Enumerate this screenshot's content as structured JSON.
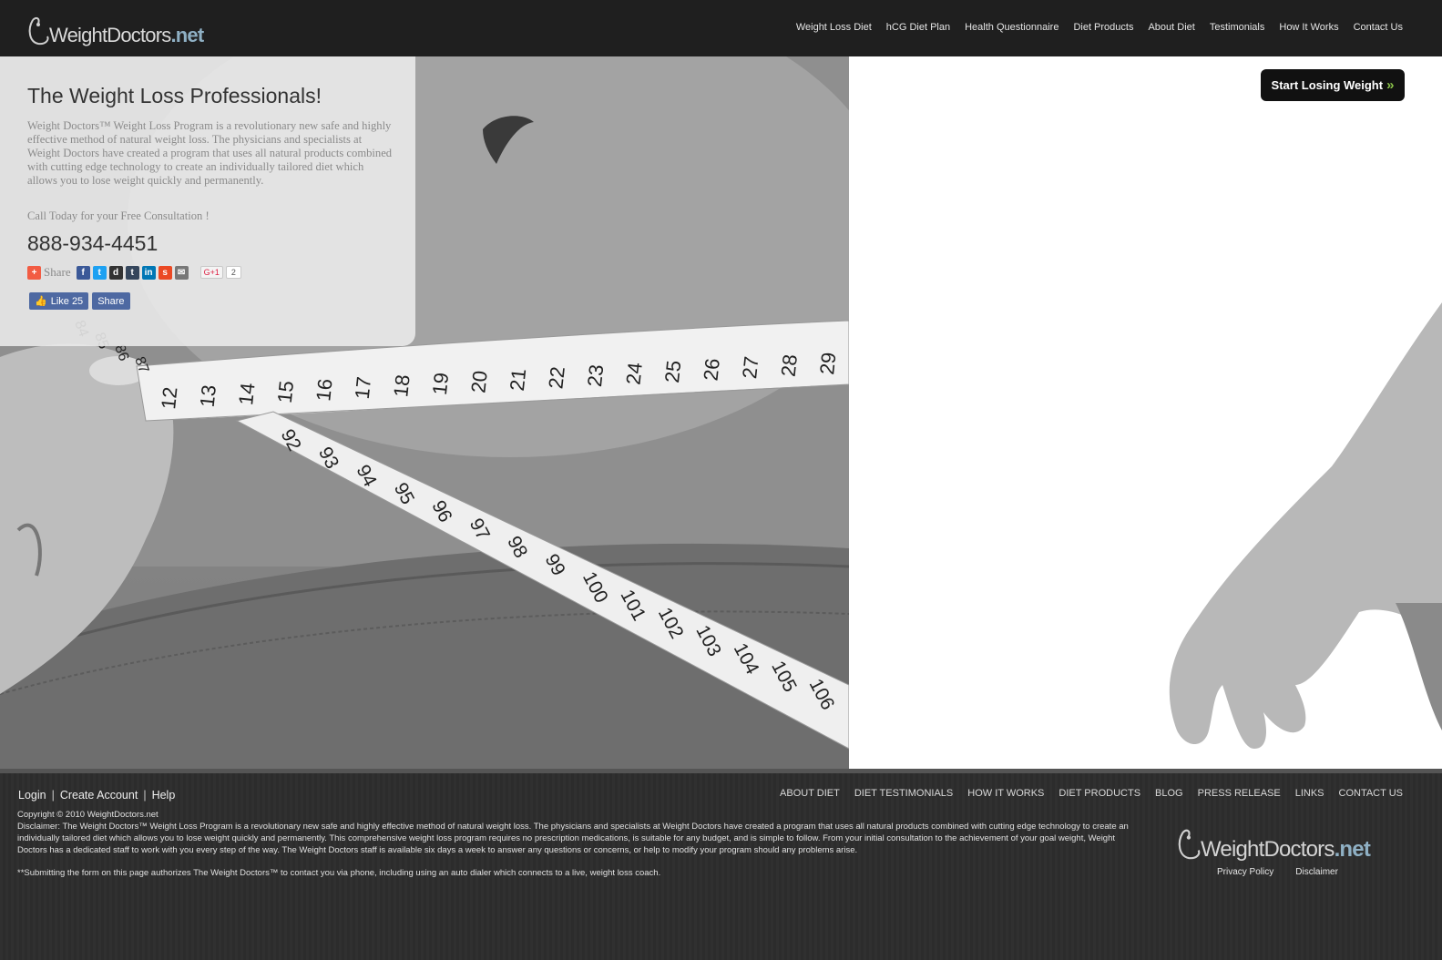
{
  "header": {
    "logo_main": "WeightDoctors",
    "logo_suffix": ".net",
    "nav": [
      {
        "label": "Weight Loss Diet"
      },
      {
        "label": "hCG Diet Plan"
      },
      {
        "label": "Health Questionnaire"
      },
      {
        "label": "Diet Products"
      },
      {
        "label": "About Diet"
      },
      {
        "label": "Testimonials"
      },
      {
        "label": "How It Works"
      },
      {
        "label": "Contact Us"
      }
    ]
  },
  "hero": {
    "title": "The Weight Loss Professionals!",
    "description": "Weight Doctors™ Weight Loss Program is a revolutionary new safe and highly effective method of natural weight loss. The physicians and specialists at Weight Doctors have created a program that uses all natural products combined with cutting edge technology to create an individually tailored diet which allows you to lose weight quickly and permanently.",
    "call_text": "Call Today for your Free Consultation !",
    "phone": "888-934-4451",
    "share_label": "Share",
    "share_icons": [
      "plus-icon",
      "facebook-icon",
      "twitter-icon",
      "digg-icon",
      "tumblr-icon",
      "linkedin-icon",
      "stumbleupon-icon",
      "email-icon"
    ],
    "gplus_label": "G+1",
    "gplus_count": "2",
    "fb_like_label": "Like 25",
    "fb_share_label": "Share",
    "cta_label": "Start Losing Weight",
    "tape_upper_numbers": [
      "12",
      "13",
      "14",
      "15",
      "16",
      "17",
      "18",
      "19",
      "20",
      "21",
      "22",
      "23",
      "24",
      "25",
      "26",
      "27",
      "28",
      "29"
    ],
    "tape_lower_numbers": [
      "92",
      "93",
      "94",
      "95",
      "96",
      "97",
      "98",
      "99",
      "100",
      "101",
      "102",
      "103",
      "104",
      "105",
      "106"
    ],
    "tape_end_numbers": [
      "84",
      "85",
      "86",
      "87"
    ]
  },
  "footer": {
    "login": "Login",
    "create_account": "Create Account",
    "help": "Help",
    "separator": "|",
    "nav": [
      {
        "label": "ABOUT DIET"
      },
      {
        "label": "DIET TESTIMONIALS"
      },
      {
        "label": "HOW IT WORKS"
      },
      {
        "label": "DIET PRODUCTS"
      },
      {
        "label": "BLOG"
      },
      {
        "label": "PRESS RELEASE"
      },
      {
        "label": "LINKS"
      },
      {
        "label": "CONTACT US"
      }
    ],
    "copyright": "Copyright © 2010 WeightDoctors.net",
    "disclaimer": "Disclaimer: The Weight Doctors™ Weight Loss Program is a revolutionary new safe and highly effective method of natural weight loss. The physicians and specialists at Weight Doctors have created a program that uses all natural products combined with cutting edge technology to create an individually tailored diet which allows you to lose weight quickly and permanently. This comprehensive weight loss program requires no prescription medications, is suitable for any budget, and is simple to follow. From your initial consultation to the achievement of your goal weight, Weight Doctors has a dedicated staff to work with you every step of the way. The Weight Doctors staff is available six days a week to answer any questions or concerns, or help to modify your program should any problems arise.",
    "form_note": "**Submitting the form on this page authorizes The Weight Doctors™ to contact you via phone, including using an auto dialer which connects to a live, weight loss coach.",
    "logo_main": "WeightDoctors",
    "logo_suffix": ".net",
    "privacy": "Privacy Policy",
    "disclaimer_link": "Disclaimer"
  }
}
